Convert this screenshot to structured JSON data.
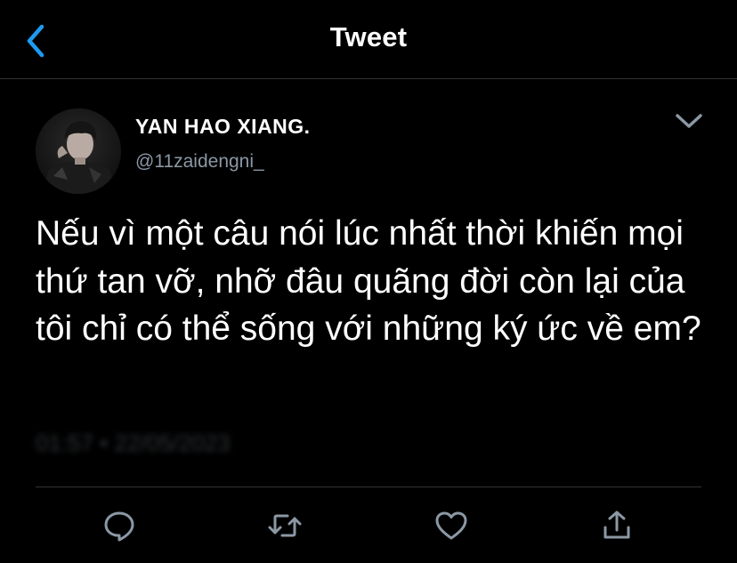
{
  "header": {
    "title": "Tweet",
    "back_icon": "chevron-left-icon"
  },
  "tweet": {
    "author_name": "YAN HAO XIANG.",
    "author_handle": "@11zaidengni_",
    "text": "Nếu vì một câu nói lúc nhất thời khiến mọi thứ tan vỡ, nhỡ đâu quãng đời còn lại của tôi chỉ có thể sống với những ký ức về em?",
    "timestamp": "01:57 • 22/05/2023"
  },
  "actions": {
    "reply_icon": "reply-icon",
    "retweet_icon": "retweet-icon",
    "like_icon": "heart-icon",
    "share_icon": "share-icon"
  },
  "colors": {
    "background": "#000000",
    "accent": "#1d9bf0",
    "secondary_text": "#8b98a5",
    "divider": "#2f3336",
    "icon": "#8b98a5"
  }
}
